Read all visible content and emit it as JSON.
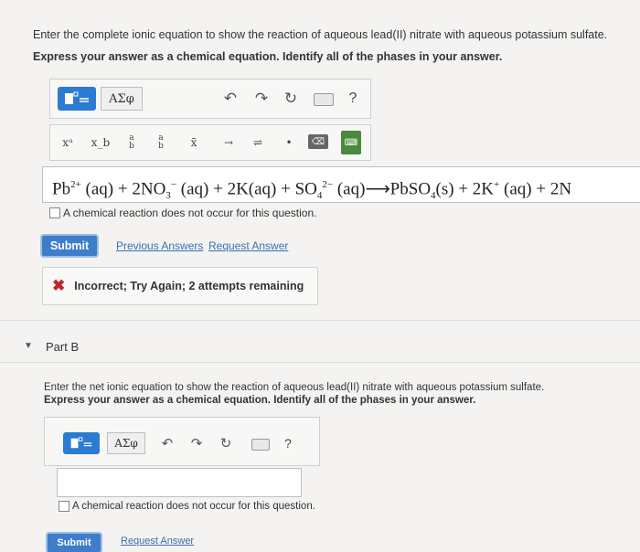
{
  "partA": {
    "prompt_line1": "Enter the complete ionic equation to show the reaction of aqueous lead(II) nitrate with aqueous potassium sulfate.",
    "prompt_line2": "Express your answer as a chemical equation. Identify all of the phases in your answer.",
    "toolbar": {
      "greek_label": "ΑΣφ",
      "help_label": "?",
      "icons": [
        "templates-icon",
        "undo-icon",
        "redo-icon",
        "reset-icon",
        "keyboard-icon",
        "help-icon"
      ]
    },
    "symbols": [
      "xᵃ",
      "x_b",
      "a/b",
      "a/b",
      "x̄",
      "→",
      "⇌",
      "•",
      "⌫",
      "⌨"
    ],
    "equation": {
      "t1": "Pb",
      "t1sup": "2+",
      "t2": " (aq) + 2NO",
      "t2sub": "3",
      "t2sup": "−",
      "t3": " (aq) + 2K(aq) + SO",
      "t3sub": "4",
      "t3sup": "2−",
      "t4": " (aq)⟶PbSO",
      "t4sub": "4",
      "t5": "(s) + 2K",
      "t5sup": "+",
      "t6": " (aq) + 2N"
    },
    "no_reaction_label": "A chemical reaction does not occur for this question.",
    "submit_label": "Submit",
    "previous_answers_label": "Previous Answers",
    "request_answer_label": "Request Answer",
    "feedback_text": "Incorrect; Try Again; 2 attempts remaining"
  },
  "partB": {
    "title": "Part B",
    "prompt_line1": "Enter the net ionic equation to show the reaction of aqueous lead(II) nitrate with aqueous potassium sulfate.",
    "prompt_line2": "Express your answer as a chemical equation. Identify all of the phases in your answer.",
    "toolbar": {
      "greek_label": "ΑΣφ",
      "help_label": "?"
    },
    "answer_value": "",
    "no_reaction_label": "A chemical reaction does not occur for this question.",
    "submit_label": "Submit",
    "request_answer_label": "Request Answer"
  },
  "colors": {
    "accent": "#2b7bd1",
    "error": "#c0262d",
    "link": "#3b6fb0"
  }
}
